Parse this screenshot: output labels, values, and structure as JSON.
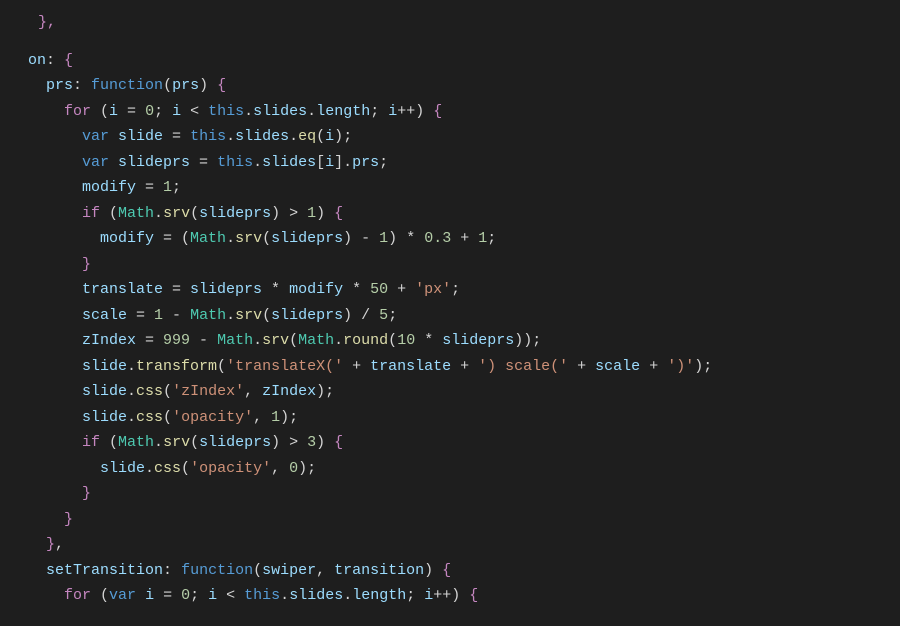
{
  "fragment_top": "},",
  "lines": [
    {
      "indent": 1,
      "tokens": [
        {
          "t": "on",
          "c": "prop"
        },
        {
          "t": ":",
          "c": "punc"
        },
        {
          "t": " ",
          "c": "punc"
        },
        {
          "t": "{",
          "c": "brace"
        }
      ]
    },
    {
      "indent": 2,
      "tokens": [
        {
          "t": "prs",
          "c": "prop"
        },
        {
          "t": ":",
          "c": "punc"
        },
        {
          "t": " ",
          "c": "punc"
        },
        {
          "t": "function",
          "c": "kw"
        },
        {
          "t": "(",
          "c": "paren"
        },
        {
          "t": "prs",
          "c": "var"
        },
        {
          "t": ")",
          "c": "paren"
        },
        {
          "t": " ",
          "c": "punc"
        },
        {
          "t": "{",
          "c": "brace"
        }
      ]
    },
    {
      "indent": 3,
      "tokens": [
        {
          "t": "for",
          "c": "key"
        },
        {
          "t": " (",
          "c": "punc"
        },
        {
          "t": "i",
          "c": "var"
        },
        {
          "t": " = ",
          "c": "op"
        },
        {
          "t": "0",
          "c": "num"
        },
        {
          "t": "; ",
          "c": "punc"
        },
        {
          "t": "i",
          "c": "var"
        },
        {
          "t": " < ",
          "c": "op"
        },
        {
          "t": "this",
          "c": "this"
        },
        {
          "t": ".",
          "c": "punc"
        },
        {
          "t": "slides",
          "c": "var"
        },
        {
          "t": ".",
          "c": "punc"
        },
        {
          "t": "length",
          "c": "var"
        },
        {
          "t": "; ",
          "c": "punc"
        },
        {
          "t": "i",
          "c": "var"
        },
        {
          "t": "++",
          "c": "op"
        },
        {
          "t": ") ",
          "c": "punc"
        },
        {
          "t": "{",
          "c": "brace"
        }
      ]
    },
    {
      "indent": 4,
      "tokens": [
        {
          "t": "var",
          "c": "kw"
        },
        {
          "t": " ",
          "c": "punc"
        },
        {
          "t": "slide",
          "c": "var"
        },
        {
          "t": " = ",
          "c": "op"
        },
        {
          "t": "this",
          "c": "this"
        },
        {
          "t": ".",
          "c": "punc"
        },
        {
          "t": "slides",
          "c": "var"
        },
        {
          "t": ".",
          "c": "punc"
        },
        {
          "t": "eq",
          "c": "func"
        },
        {
          "t": "(",
          "c": "paren"
        },
        {
          "t": "i",
          "c": "var"
        },
        {
          "t": ")",
          "c": "paren"
        },
        {
          "t": ";",
          "c": "punc"
        }
      ]
    },
    {
      "indent": 4,
      "tokens": [
        {
          "t": "var",
          "c": "kw"
        },
        {
          "t": " ",
          "c": "punc"
        },
        {
          "t": "slideprs",
          "c": "var"
        },
        {
          "t": " = ",
          "c": "op"
        },
        {
          "t": "this",
          "c": "this"
        },
        {
          "t": ".",
          "c": "punc"
        },
        {
          "t": "slides",
          "c": "var"
        },
        {
          "t": "[",
          "c": "punc"
        },
        {
          "t": "i",
          "c": "var"
        },
        {
          "t": "].",
          "c": "punc"
        },
        {
          "t": "prs",
          "c": "var"
        },
        {
          "t": ";",
          "c": "punc"
        }
      ]
    },
    {
      "indent": 4,
      "tokens": [
        {
          "t": "modify",
          "c": "var"
        },
        {
          "t": " = ",
          "c": "op"
        },
        {
          "t": "1",
          "c": "num"
        },
        {
          "t": ";",
          "c": "punc"
        }
      ]
    },
    {
      "indent": 4,
      "tokens": [
        {
          "t": "if",
          "c": "key"
        },
        {
          "t": " (",
          "c": "punc"
        },
        {
          "t": "Math",
          "c": "class"
        },
        {
          "t": ".",
          "c": "punc"
        },
        {
          "t": "srv",
          "c": "func"
        },
        {
          "t": "(",
          "c": "paren"
        },
        {
          "t": "slideprs",
          "c": "var"
        },
        {
          "t": ")",
          "c": "paren"
        },
        {
          "t": " > ",
          "c": "op"
        },
        {
          "t": "1",
          "c": "num"
        },
        {
          "t": ") ",
          "c": "punc"
        },
        {
          "t": "{",
          "c": "brace"
        }
      ]
    },
    {
      "indent": 5,
      "tokens": [
        {
          "t": "modify",
          "c": "var"
        },
        {
          "t": " = ",
          "c": "op"
        },
        {
          "t": "(",
          "c": "paren"
        },
        {
          "t": "Math",
          "c": "class"
        },
        {
          "t": ".",
          "c": "punc"
        },
        {
          "t": "srv",
          "c": "func"
        },
        {
          "t": "(",
          "c": "paren"
        },
        {
          "t": "slideprs",
          "c": "var"
        },
        {
          "t": ")",
          "c": "paren"
        },
        {
          "t": " - ",
          "c": "op"
        },
        {
          "t": "1",
          "c": "num"
        },
        {
          "t": ")",
          "c": "paren"
        },
        {
          "t": " * ",
          "c": "op"
        },
        {
          "t": "0.3",
          "c": "num"
        },
        {
          "t": " + ",
          "c": "op"
        },
        {
          "t": "1",
          "c": "num"
        },
        {
          "t": ";",
          "c": "punc"
        }
      ]
    },
    {
      "indent": 4,
      "tokens": [
        {
          "t": "}",
          "c": "brace"
        }
      ]
    },
    {
      "indent": 4,
      "tokens": [
        {
          "t": "translate",
          "c": "var"
        },
        {
          "t": " = ",
          "c": "op"
        },
        {
          "t": "slideprs",
          "c": "var"
        },
        {
          "t": " * ",
          "c": "op"
        },
        {
          "t": "modify",
          "c": "var"
        },
        {
          "t": " * ",
          "c": "op"
        },
        {
          "t": "50",
          "c": "num"
        },
        {
          "t": " + ",
          "c": "op"
        },
        {
          "t": "'px'",
          "c": "str"
        },
        {
          "t": ";",
          "c": "punc"
        }
      ]
    },
    {
      "indent": 4,
      "tokens": [
        {
          "t": "scale",
          "c": "var"
        },
        {
          "t": " = ",
          "c": "op"
        },
        {
          "t": "1",
          "c": "num"
        },
        {
          "t": " - ",
          "c": "op"
        },
        {
          "t": "Math",
          "c": "class"
        },
        {
          "t": ".",
          "c": "punc"
        },
        {
          "t": "srv",
          "c": "func"
        },
        {
          "t": "(",
          "c": "paren"
        },
        {
          "t": "slideprs",
          "c": "var"
        },
        {
          "t": ")",
          "c": "paren"
        },
        {
          "t": " / ",
          "c": "op"
        },
        {
          "t": "5",
          "c": "num"
        },
        {
          "t": ";",
          "c": "punc"
        }
      ]
    },
    {
      "indent": 4,
      "tokens": [
        {
          "t": "zIndex",
          "c": "var"
        },
        {
          "t": " = ",
          "c": "op"
        },
        {
          "t": "999",
          "c": "num"
        },
        {
          "t": " - ",
          "c": "op"
        },
        {
          "t": "Math",
          "c": "class"
        },
        {
          "t": ".",
          "c": "punc"
        },
        {
          "t": "srv",
          "c": "func"
        },
        {
          "t": "(",
          "c": "paren"
        },
        {
          "t": "Math",
          "c": "class"
        },
        {
          "t": ".",
          "c": "punc"
        },
        {
          "t": "round",
          "c": "func"
        },
        {
          "t": "(",
          "c": "paren"
        },
        {
          "t": "10",
          "c": "num"
        },
        {
          "t": " * ",
          "c": "op"
        },
        {
          "t": "slideprs",
          "c": "var"
        },
        {
          "t": ")",
          "c": "paren"
        },
        {
          "t": ")",
          "c": "paren"
        },
        {
          "t": ";",
          "c": "punc"
        }
      ]
    },
    {
      "indent": 4,
      "tokens": [
        {
          "t": "slide",
          "c": "var"
        },
        {
          "t": ".",
          "c": "punc"
        },
        {
          "t": "transform",
          "c": "func"
        },
        {
          "t": "(",
          "c": "paren"
        },
        {
          "t": "'translateX('",
          "c": "str"
        },
        {
          "t": " + ",
          "c": "op"
        },
        {
          "t": "translate",
          "c": "var"
        },
        {
          "t": " + ",
          "c": "op"
        },
        {
          "t": "') scale('",
          "c": "str"
        },
        {
          "t": " + ",
          "c": "op"
        },
        {
          "t": "scale",
          "c": "var"
        },
        {
          "t": " + ",
          "c": "op"
        },
        {
          "t": "')'",
          "c": "str"
        },
        {
          "t": ")",
          "c": "paren"
        },
        {
          "t": ";",
          "c": "punc"
        }
      ]
    },
    {
      "indent": 4,
      "tokens": [
        {
          "t": "slide",
          "c": "var"
        },
        {
          "t": ".",
          "c": "punc"
        },
        {
          "t": "css",
          "c": "func"
        },
        {
          "t": "(",
          "c": "paren"
        },
        {
          "t": "'zIndex'",
          "c": "str"
        },
        {
          "t": ", ",
          "c": "punc"
        },
        {
          "t": "zIndex",
          "c": "var"
        },
        {
          "t": ")",
          "c": "paren"
        },
        {
          "t": ";",
          "c": "punc"
        }
      ]
    },
    {
      "indent": 4,
      "tokens": [
        {
          "t": "slide",
          "c": "var"
        },
        {
          "t": ".",
          "c": "punc"
        },
        {
          "t": "css",
          "c": "func"
        },
        {
          "t": "(",
          "c": "paren"
        },
        {
          "t": "'opacity'",
          "c": "str"
        },
        {
          "t": ", ",
          "c": "punc"
        },
        {
          "t": "1",
          "c": "num"
        },
        {
          "t": ")",
          "c": "paren"
        },
        {
          "t": ";",
          "c": "punc"
        }
      ]
    },
    {
      "indent": 4,
      "tokens": [
        {
          "t": "if",
          "c": "key"
        },
        {
          "t": " (",
          "c": "punc"
        },
        {
          "t": "Math",
          "c": "class"
        },
        {
          "t": ".",
          "c": "punc"
        },
        {
          "t": "srv",
          "c": "func"
        },
        {
          "t": "(",
          "c": "paren"
        },
        {
          "t": "slideprs",
          "c": "var"
        },
        {
          "t": ")",
          "c": "paren"
        },
        {
          "t": " > ",
          "c": "op"
        },
        {
          "t": "3",
          "c": "num"
        },
        {
          "t": ") ",
          "c": "punc"
        },
        {
          "t": "{",
          "c": "brace"
        }
      ]
    },
    {
      "indent": 5,
      "tokens": [
        {
          "t": "slide",
          "c": "var"
        },
        {
          "t": ".",
          "c": "punc"
        },
        {
          "t": "css",
          "c": "func"
        },
        {
          "t": "(",
          "c": "paren"
        },
        {
          "t": "'opacity'",
          "c": "str"
        },
        {
          "t": ", ",
          "c": "punc"
        },
        {
          "t": "0",
          "c": "num"
        },
        {
          "t": ")",
          "c": "paren"
        },
        {
          "t": ";",
          "c": "punc"
        }
      ]
    },
    {
      "indent": 4,
      "tokens": [
        {
          "t": "}",
          "c": "brace"
        }
      ]
    },
    {
      "indent": 3,
      "tokens": [
        {
          "t": "}",
          "c": "brace"
        }
      ]
    },
    {
      "indent": 2,
      "tokens": [
        {
          "t": "}",
          "c": "brace"
        },
        {
          "t": ",",
          "c": "punc"
        }
      ]
    },
    {
      "indent": 2,
      "tokens": [
        {
          "t": "setTransition",
          "c": "prop"
        },
        {
          "t": ":",
          "c": "punc"
        },
        {
          "t": " ",
          "c": "punc"
        },
        {
          "t": "function",
          "c": "kw"
        },
        {
          "t": "(",
          "c": "paren"
        },
        {
          "t": "swiper",
          "c": "var"
        },
        {
          "t": ", ",
          "c": "punc"
        },
        {
          "t": "transition",
          "c": "var"
        },
        {
          "t": ")",
          "c": "paren"
        },
        {
          "t": " ",
          "c": "punc"
        },
        {
          "t": "{",
          "c": "brace"
        }
      ]
    },
    {
      "indent": 3,
      "tokens": [
        {
          "t": "for",
          "c": "key"
        },
        {
          "t": " (",
          "c": "punc"
        },
        {
          "t": "var",
          "c": "kw"
        },
        {
          "t": " ",
          "c": "punc"
        },
        {
          "t": "i",
          "c": "var"
        },
        {
          "t": " = ",
          "c": "op"
        },
        {
          "t": "0",
          "c": "num"
        },
        {
          "t": "; ",
          "c": "punc"
        },
        {
          "t": "i",
          "c": "var"
        },
        {
          "t": " < ",
          "c": "op"
        },
        {
          "t": "this",
          "c": "this"
        },
        {
          "t": ".",
          "c": "punc"
        },
        {
          "t": "slides",
          "c": "var"
        },
        {
          "t": ".",
          "c": "punc"
        },
        {
          "t": "length",
          "c": "var"
        },
        {
          "t": "; ",
          "c": "punc"
        },
        {
          "t": "i",
          "c": "var"
        },
        {
          "t": "++",
          "c": "op"
        },
        {
          "t": ") ",
          "c": "punc"
        },
        {
          "t": "{",
          "c": "brace"
        }
      ]
    }
  ]
}
